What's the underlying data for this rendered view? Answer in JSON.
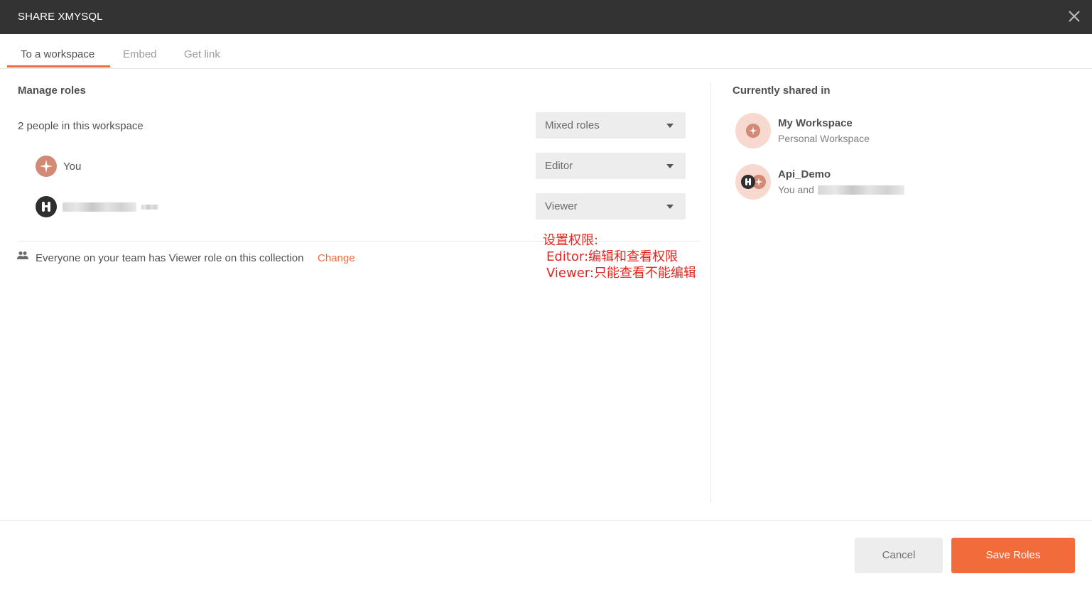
{
  "dialog": {
    "title": "SHARE XMYSQL",
    "close_icon": "close-icon"
  },
  "tabs": [
    {
      "label": "To a workspace",
      "active": true
    },
    {
      "label": "Embed",
      "active": false
    },
    {
      "label": "Get link",
      "active": false
    }
  ],
  "left": {
    "heading": "Manage roles",
    "people_count_text": "2 people in this workspace",
    "bulk_role": "Mixed roles",
    "members": [
      {
        "name": "You",
        "role": "Editor",
        "avatar": "sparkle-avatar-icon"
      },
      {
        "name": "",
        "role": "Viewer",
        "avatar": "postman-avatar-icon"
      }
    ],
    "team_notice": "Everyone on your team has Viewer role on this collection",
    "team_notice_link": "Change"
  },
  "annotation": {
    "line1": "设置权限:",
    "line2": "Editor:编辑和查看权限",
    "line3": "Viewer:只能查看不能编辑",
    "color": "#e8241c"
  },
  "right": {
    "heading": "Currently shared in",
    "workspaces": [
      {
        "name": "My Workspace",
        "subtitle": "Personal Workspace"
      },
      {
        "name": "Api_Demo",
        "subtitle": "You and"
      }
    ]
  },
  "footer": {
    "cancel_label": "Cancel",
    "save_label": "Save Roles"
  },
  "colors": {
    "accent": "#f26b3a",
    "titlebar": "#333333"
  }
}
